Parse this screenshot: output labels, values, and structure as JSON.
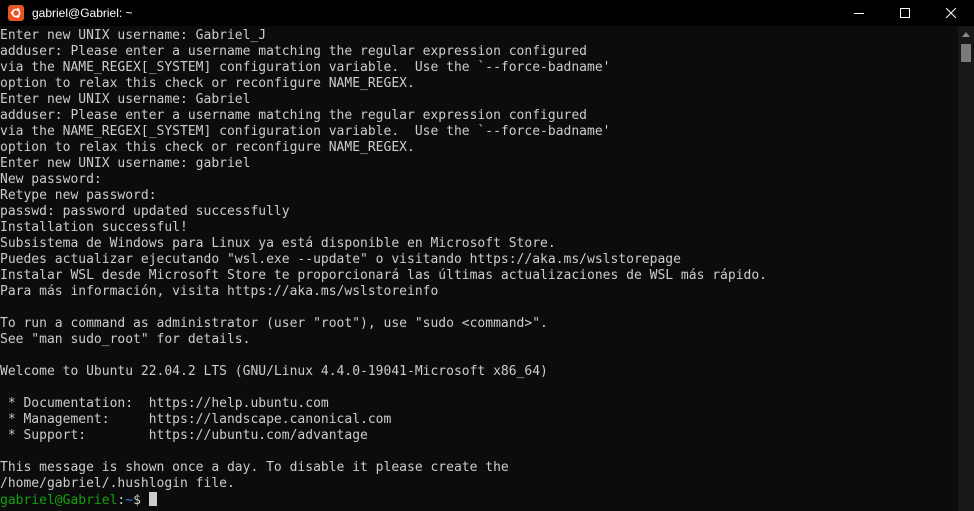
{
  "window": {
    "title": "gabriel@Gabriel: ~",
    "app_icon": "ubuntu-icon",
    "brand_color": "#e95420"
  },
  "terminal": {
    "lines": [
      "Enter new UNIX username: Gabriel_J",
      "adduser: Please enter a username matching the regular expression configured",
      "via the NAME_REGEX[_SYSTEM] configuration variable.  Use the `--force-badname'",
      "option to relax this check or reconfigure NAME_REGEX.",
      "Enter new UNIX username: Gabriel",
      "adduser: Please enter a username matching the regular expression configured",
      "via the NAME_REGEX[_SYSTEM] configuration variable.  Use the `--force-badname'",
      "option to relax this check or reconfigure NAME_REGEX.",
      "Enter new UNIX username: gabriel",
      "New password:",
      "Retype new password:",
      "passwd: password updated successfully",
      "Installation successful!",
      "Subsistema de Windows para Linux ya está disponible en Microsoft Store.",
      "Puedes actualizar ejecutando \"wsl.exe --update\" o visitando https://aka.ms/wslstorepage",
      "Instalar WSL desde Microsoft Store te proporcionará las últimas actualizaciones de WSL más rápido.",
      "Para más información, visita https://aka.ms/wslstoreinfo",
      "",
      "To run a command as administrator (user \"root\"), use \"sudo <command>\".",
      "See \"man sudo_root\" for details.",
      "",
      "Welcome to Ubuntu 22.04.2 LTS (GNU/Linux 4.4.0-19041-Microsoft x86_64)",
      "",
      " * Documentation:  https://help.ubuntu.com",
      " * Management:     https://landscape.canonical.com",
      " * Support:        https://ubuntu.com/advantage",
      "",
      "This message is shown once a day. To disable it please create the",
      "/home/gabriel/.hushlogin file."
    ],
    "prompt": {
      "user_host": "gabriel@Gabriel",
      "separator": ":",
      "path": "~",
      "symbol": "$ "
    },
    "colors": {
      "text": "#cccccc",
      "background": "#0c0c0c",
      "prompt_user": "#13a10e",
      "prompt_path": "#3b78ff"
    }
  }
}
